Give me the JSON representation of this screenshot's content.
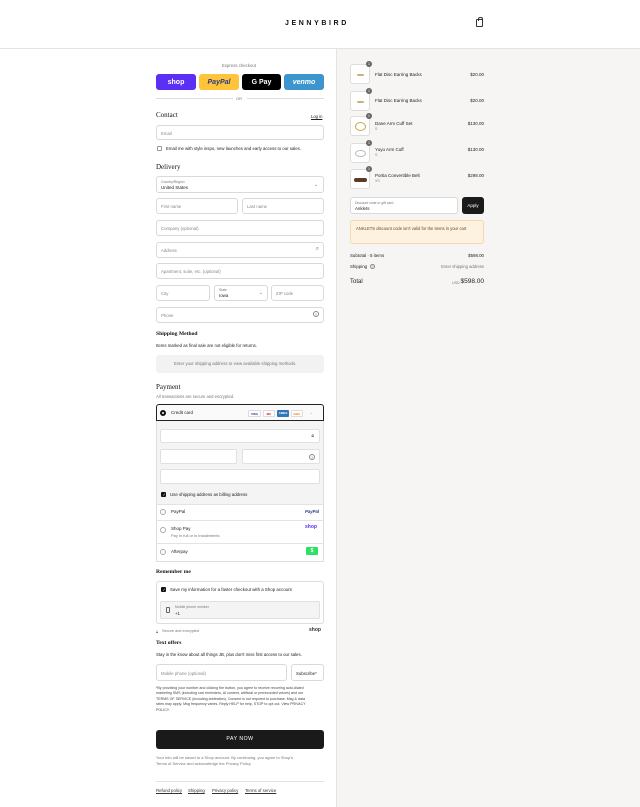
{
  "header": {
    "brand": "JENNYBIRD"
  },
  "express": {
    "label": "Express checkout",
    "buttons": [
      {
        "label": "shop",
        "color": "#5a31f4"
      },
      {
        "label": "PayPal",
        "color": "#ffc439"
      },
      {
        "label": "G Pay",
        "color": "#000000"
      },
      {
        "label": "venmo",
        "color": "#3d95ce"
      }
    ],
    "or": "OR"
  },
  "contact": {
    "title": "Contact",
    "login": "Log in",
    "email_placeholder": "Email",
    "news_label": "Email me with style inspo, new launches and early access to our sales."
  },
  "delivery": {
    "title": "Delivery",
    "country_label": "Country/Region",
    "country_value": "United States",
    "first_name": "First name",
    "last_name": "Last name",
    "company": "Company (optional)",
    "address": "Address",
    "apartment": "Apartment, suite, etc. (optional)",
    "city": "City",
    "state_label": "State",
    "state_value": "Iowa",
    "zip": "ZIP code",
    "phone": "Phone"
  },
  "shipping_method": {
    "title": "Shipping Method",
    "note": "Items marked as final sale are not eligible for returns.",
    "placeholder": "Enter your shipping address to view available shipping methods."
  },
  "payment": {
    "title": "Payment",
    "subtitle": "All transactions are secure and encrypted.",
    "credit_card": "Credit card",
    "card_logos": [
      {
        "label": "VISA",
        "color": "#1a1f71"
      },
      {
        "label": "MC",
        "color": "#eb001b"
      },
      {
        "label": "AMEX",
        "color": "#2e77bb"
      },
      {
        "label": "DISC",
        "color": "#f58220"
      }
    ],
    "more": "+1",
    "billing_same": "Use shipping address as billing address",
    "paypal": "PayPal",
    "paypal_logo": "PayPal",
    "shoppay": "Shop Pay",
    "shoppay_sub": "Pay in full or in installments",
    "shoppay_logo": "shop",
    "afterpay": "Afterpay",
    "afterpay_logo": "$"
  },
  "remember": {
    "title": "Remember me",
    "save_label": "Save my information for a faster checkout with a Shop account",
    "mobile_label": "Mobile phone number",
    "mobile_prefix": "+1",
    "secure": "Secure and encrypted",
    "shop_logo": "shop"
  },
  "text_offers": {
    "title": "Text offers",
    "subtitle": "Stay in the know about all things JB, plus don't miss first access to our sales.",
    "mobile_placeholder": "Mobile phone (optional)",
    "subscribe": "Subscribe*",
    "legal_1": "*By providing your number and clicking the button, you agree to receive recurring auto-dialed",
    "legal_2": "marketing SMS (including cart reminders, AI content, artificial or prerecorded voices) and our",
    "legal_3": "TERMS OF SERVICE (including arbitration). Consent is not required to purchase. Msg & data",
    "legal_4": "rates may apply. Msg frequency varies. Reply HELP for help, STOP to opt out. View PRIVACY",
    "legal_5": "POLICY."
  },
  "pay_now": "PAY NOW",
  "footer_note_1": "Your info will be saved to a Shop account. By continuing, you agree to Shop's",
  "footer_note_2": "Terms of Service and acknowledge the Privacy Policy.",
  "footer_links": [
    "Refund policy",
    "Shipping",
    "Privacy policy",
    "Terms of service"
  ],
  "cart": {
    "items": [
      {
        "name": "Flat Disc Earring Backs",
        "variant": "",
        "qty": "1",
        "price": "$20.00"
      },
      {
        "name": "Flat Disc Earring Backs",
        "variant": "",
        "qty": "1",
        "price": "$20.00"
      },
      {
        "name": "Dane Arm Cuff Set",
        "variant": "S",
        "qty": "1",
        "price": "$130.00"
      },
      {
        "name": "Yuyu Arm Cuff",
        "variant": "S",
        "qty": "1",
        "price": "$130.00"
      },
      {
        "name": "Portia Convertible Belt",
        "variant": "XS",
        "qty": "1",
        "price": "$298.00"
      }
    ],
    "discount_label": "Discount code or gift card",
    "discount_value": "Anklets",
    "apply": "Apply",
    "error": "ANKLETS discount code isn't valid for the items in your cart",
    "subtotal_label": "Subtotal · 5 items",
    "subtotal_value": "$598.00",
    "shipping_label": "Shipping",
    "shipping_value": "Enter shipping address",
    "total_label": "Total",
    "currency": "USD",
    "total_value": "$598.00"
  }
}
